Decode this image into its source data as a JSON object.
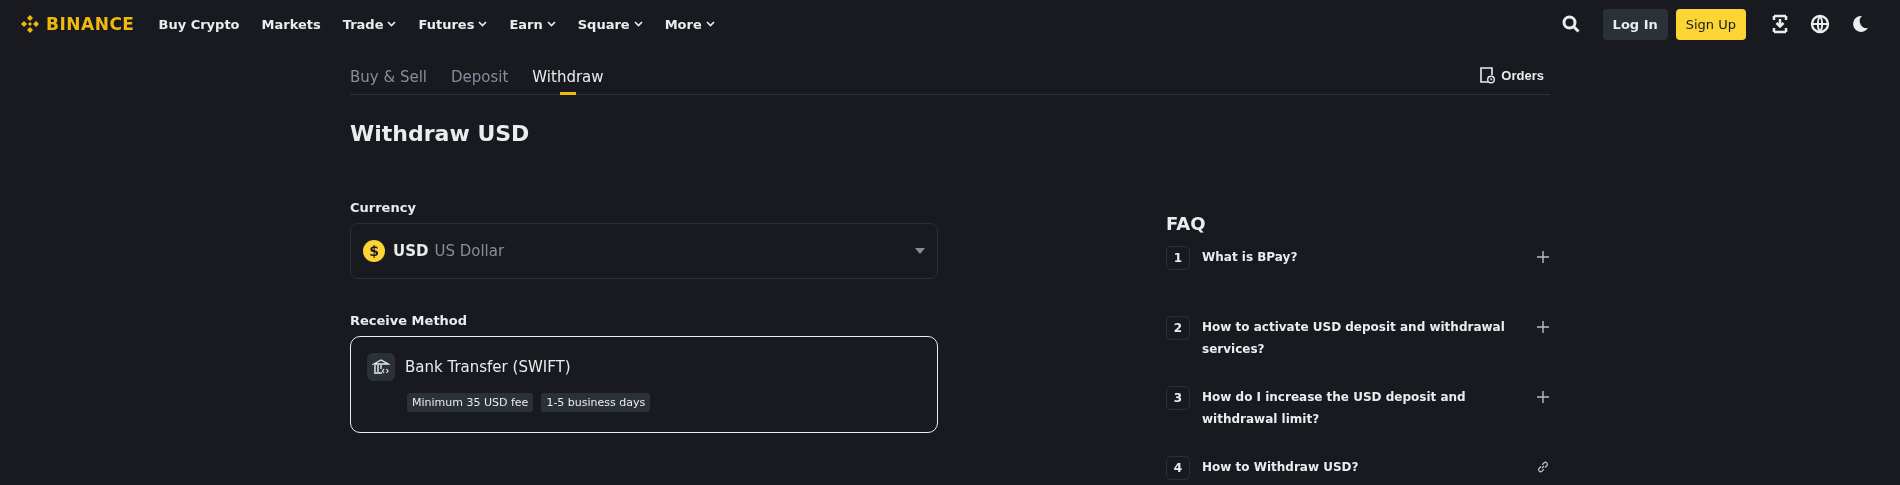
{
  "header": {
    "logo": "BINANCE",
    "nav": [
      {
        "label": "Buy Crypto",
        "dropdown": false
      },
      {
        "label": "Markets",
        "dropdown": false
      },
      {
        "label": "Trade",
        "dropdown": true
      },
      {
        "label": "Futures",
        "dropdown": true
      },
      {
        "label": "Earn",
        "dropdown": true
      },
      {
        "label": "Square",
        "dropdown": true
      },
      {
        "label": "More",
        "dropdown": true
      }
    ],
    "login": "Log In",
    "signup": "Sign Up"
  },
  "tabs": [
    {
      "label": "Buy & Sell",
      "selected": false
    },
    {
      "label": "Deposit",
      "selected": false
    },
    {
      "label": "Withdraw",
      "selected": true
    }
  ],
  "orders": "Orders",
  "title": "Withdraw USD",
  "currency": {
    "label": "Currency",
    "symbol": "$",
    "code": "USD",
    "name": "US Dollar"
  },
  "receive_method": {
    "label": "Receive Method",
    "name": "Bank Transfer (SWIFT)",
    "tags": [
      "Minimum 35 USD fee",
      "1-5 business days"
    ]
  },
  "faq": {
    "title": "FAQ",
    "items": [
      {
        "number": "1",
        "question": "What is BPay?",
        "kind": "expand"
      },
      {
        "number": "2",
        "question": "How to activate USD deposit and withdrawal services?",
        "kind": "expand"
      },
      {
        "number": "3",
        "question": "How do I increase the USD deposit and withdrawal limit?",
        "kind": "expand"
      },
      {
        "number": "4",
        "question": "How to Withdraw USD?",
        "kind": "link"
      }
    ]
  }
}
